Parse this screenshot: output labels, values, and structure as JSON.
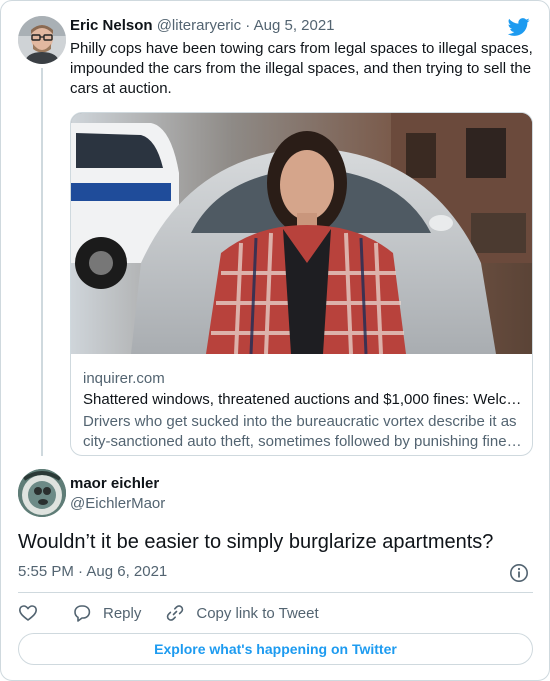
{
  "original_tweet": {
    "author_name": "Eric Nelson",
    "author_handle": "@literaryeric",
    "date": "Aug 5, 2021",
    "separator": "·",
    "text": "Philly cops have been towing cars from legal spaces to illegal spaces, impounded the cars from the illegal spaces, and then trying to sell the cars at auction.",
    "link_card": {
      "domain": "inquirer.com",
      "title": "Shattered windows, threatened auctions and $1,000 fines: Welcome to Philly's towing nightmare",
      "description": "Drivers who get sucked into the bureaucratic vortex describe it as city-sanctioned auto theft, sometimes followed by punishing fines and fees."
    }
  },
  "reply_tweet": {
    "author_name": "maor eichler",
    "author_handle": "@EichlerMaor",
    "text": "Wouldn’t it be easier to simply burglarize apartments?",
    "timestamp": "5:55 PM · Aug 6, 2021"
  },
  "actions": {
    "like_icon": "heart-icon",
    "reply_label": "Reply",
    "reply_icon": "speech-bubble-icon",
    "copy_link_label": "Copy link to Tweet",
    "copy_link_icon": "link-icon"
  },
  "explore_label": "Explore what's happening on Twitter",
  "colors": {
    "twitter_blue": "#1d9bf0",
    "text_primary": "#0f1419",
    "text_secondary": "#536471",
    "border": "#cfd9de"
  }
}
